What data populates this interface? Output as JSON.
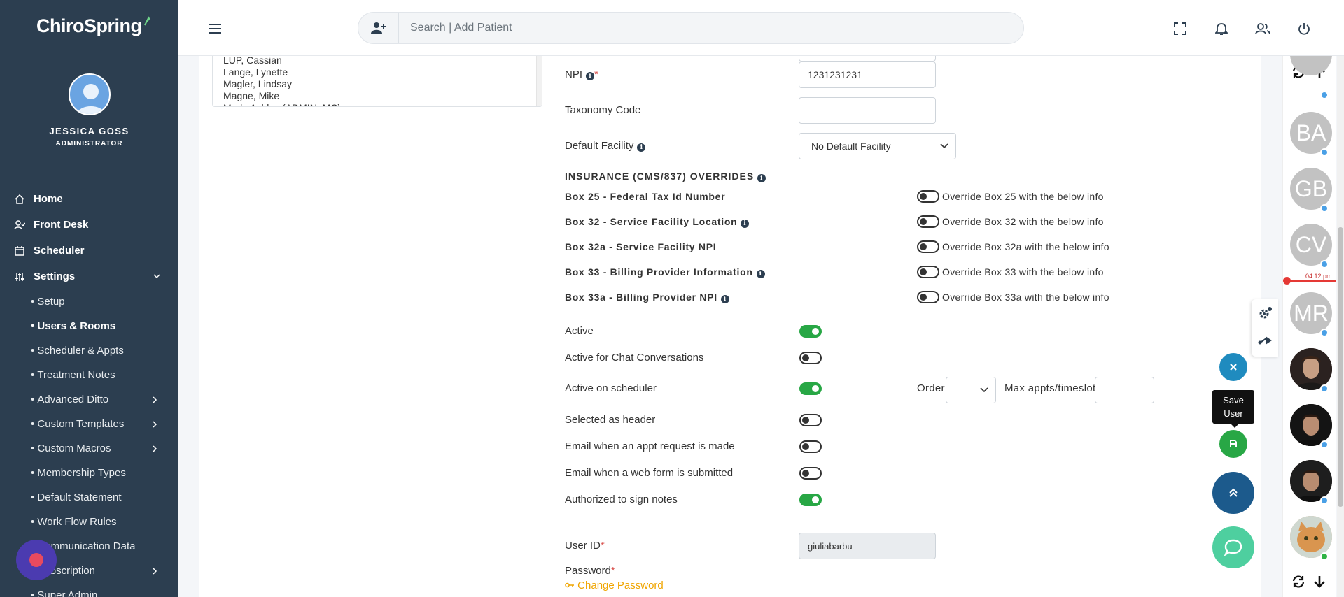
{
  "app": {
    "logo_text": "ChiroSpring"
  },
  "user": {
    "name": "JESSICA GOSS",
    "role": "ADMINISTRATOR"
  },
  "nav": {
    "home": "Home",
    "front_desk": "Front Desk",
    "scheduler": "Scheduler",
    "settings": "Settings",
    "sub_items": [
      {
        "label": "Setup",
        "has_children": false
      },
      {
        "label": "Users & Rooms",
        "has_children": false,
        "active": true
      },
      {
        "label": "Scheduler & Appts",
        "has_children": false
      },
      {
        "label": "Treatment Notes",
        "has_children": false
      },
      {
        "label": "Advanced Ditto",
        "has_children": true
      },
      {
        "label": "Custom Templates",
        "has_children": true
      },
      {
        "label": "Custom Macros",
        "has_children": true
      },
      {
        "label": "Membership Types",
        "has_children": false
      },
      {
        "label": "Default Statement",
        "has_children": false
      },
      {
        "label": "Work Flow Rules",
        "has_children": false
      },
      {
        "label": "Communication Data",
        "has_children": false
      },
      {
        "label": "Subscription",
        "has_children": true
      },
      {
        "label": "Super Admin",
        "has_children": false
      }
    ]
  },
  "topbar": {
    "search_placeholder": "Search | Add Patient"
  },
  "listbox": {
    "items": [
      "LUP, Cassian",
      "Lange, Lynette",
      "Magler, Lindsay",
      "Magne, Mike",
      "Mark, Ashley (ADMIN, MC)"
    ]
  },
  "form": {
    "npi_label": "NPI",
    "npi_value": "1231231231",
    "taxonomy_label": "Taxonomy Code",
    "taxonomy_value": "",
    "default_facility_label": "Default Facility",
    "default_facility_value": "No Default Facility",
    "overrides_heading": "INSURANCE (CMS/837) OVERRIDES",
    "overrides": [
      {
        "label": "Box 25 - Federal Tax Id Number",
        "info": false,
        "toggle_text": "Override Box 25 with the below info",
        "on": false
      },
      {
        "label": "Box 32 - Service Facility Location",
        "info": true,
        "toggle_text": "Override Box 32 with the below info",
        "on": false
      },
      {
        "label": "Box 32a - Service Facility NPI",
        "info": false,
        "toggle_text": "Override Box 32a with the below info",
        "on": false
      },
      {
        "label": "Box 33 - Billing Provider Information",
        "info": true,
        "toggle_text": "Override Box 33 with the below info",
        "on": false
      },
      {
        "label": "Box 33a - Billing Provider NPI",
        "info": true,
        "toggle_text": "Override Box 33a with the below info",
        "on": false
      }
    ],
    "toggles": [
      {
        "label": "Active",
        "on": true
      },
      {
        "label": "Active for Chat Conversations",
        "on": false
      },
      {
        "label": "Active on scheduler",
        "on": true
      },
      {
        "label": "Selected as header",
        "on": false
      },
      {
        "label": "Email when an appt request is made",
        "on": false
      },
      {
        "label": "Email when a web form is submitted",
        "on": false
      },
      {
        "label": "Authorized to sign notes",
        "on": true
      }
    ],
    "order_label": "Order",
    "max_appts_label": "Max appts/timeslot",
    "user_id_label": "User ID",
    "user_id_value": "giuliabarbu",
    "password_label": "Password",
    "change_password_label": "Change Password",
    "required_mark": "*"
  },
  "rail": {
    "avatars": [
      "BA",
      "GB",
      "CV",
      "MR"
    ],
    "time_label": "04:12 pm"
  },
  "tooltip": {
    "save_user": "Save User"
  },
  "colors": {
    "sidebar": "#2c3e50",
    "toggle_on": "#28a745",
    "link": "#f0a500",
    "danger": "#e53935"
  }
}
